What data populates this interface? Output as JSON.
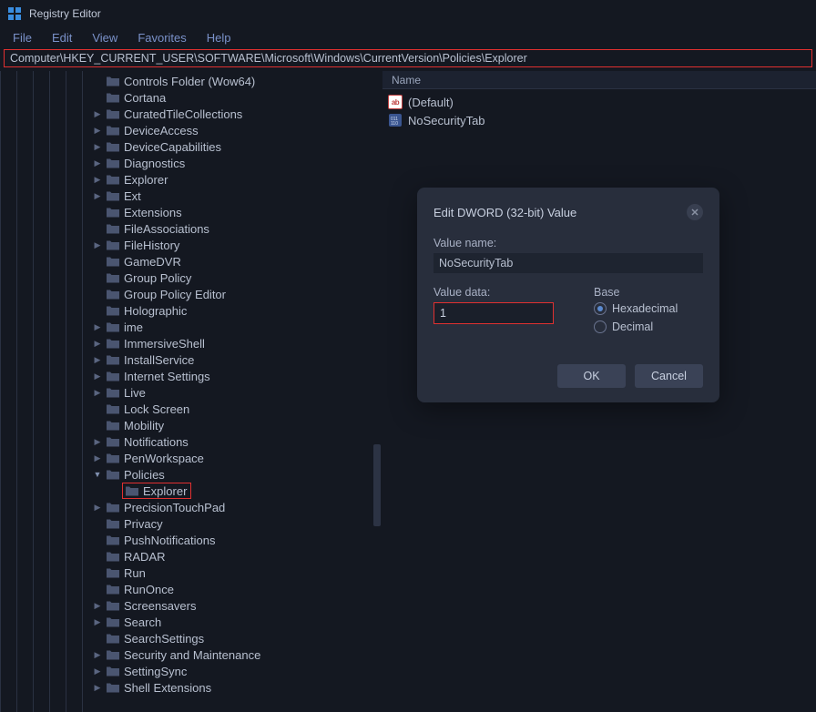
{
  "app": {
    "title": "Registry Editor"
  },
  "menu": {
    "file": "File",
    "edit": "Edit",
    "view": "View",
    "favorites": "Favorites",
    "help": "Help"
  },
  "path": "Computer\\HKEY_CURRENT_USER\\SOFTWARE\\Microsoft\\Windows\\CurrentVersion\\Policies\\Explorer",
  "tree": {
    "items": [
      {
        "label": "Controls Folder (Wow64)",
        "exp": false
      },
      {
        "label": "Cortana",
        "exp": false
      },
      {
        "label": "CuratedTileCollections",
        "exp": true
      },
      {
        "label": "DeviceAccess",
        "exp": true
      },
      {
        "label": "DeviceCapabilities",
        "exp": true
      },
      {
        "label": "Diagnostics",
        "exp": true
      },
      {
        "label": "Explorer",
        "exp": true
      },
      {
        "label": "Ext",
        "exp": true
      },
      {
        "label": "Extensions",
        "exp": false
      },
      {
        "label": "FileAssociations",
        "exp": false
      },
      {
        "label": "FileHistory",
        "exp": true
      },
      {
        "label": "GameDVR",
        "exp": false
      },
      {
        "label": "Group Policy",
        "exp": false
      },
      {
        "label": "Group Policy Editor",
        "exp": false
      },
      {
        "label": "Holographic",
        "exp": false
      },
      {
        "label": "ime",
        "exp": true
      },
      {
        "label": "ImmersiveShell",
        "exp": true
      },
      {
        "label": "InstallService",
        "exp": true
      },
      {
        "label": "Internet Settings",
        "exp": true
      },
      {
        "label": "Live",
        "exp": true
      },
      {
        "label": "Lock Screen",
        "exp": false
      },
      {
        "label": "Mobility",
        "exp": false
      },
      {
        "label": "Notifications",
        "exp": true
      },
      {
        "label": "PenWorkspace",
        "exp": true
      },
      {
        "label": "Policies",
        "exp": true,
        "open": true
      },
      {
        "label": "Explorer",
        "child": true,
        "highlighted": true
      },
      {
        "label": "PrecisionTouchPad",
        "exp": true
      },
      {
        "label": "Privacy",
        "exp": false
      },
      {
        "label": "PushNotifications",
        "exp": false
      },
      {
        "label": "RADAR",
        "exp": false
      },
      {
        "label": "Run",
        "exp": false
      },
      {
        "label": "RunOnce",
        "exp": false
      },
      {
        "label": "Screensavers",
        "exp": true
      },
      {
        "label": "Search",
        "exp": true
      },
      {
        "label": "SearchSettings",
        "exp": false
      },
      {
        "label": "Security and Maintenance",
        "exp": true
      },
      {
        "label": "SettingSync",
        "exp": true
      },
      {
        "label": "Shell Extensions",
        "exp": true
      }
    ]
  },
  "list": {
    "header": "Name",
    "items": [
      {
        "label": "(Default)",
        "type": "ab"
      },
      {
        "label": "NoSecurityTab",
        "type": "bin"
      }
    ]
  },
  "dialog": {
    "title": "Edit DWORD (32-bit) Value",
    "name_label": "Value name:",
    "name_value": "NoSecurityTab",
    "data_label": "Value data:",
    "data_value": "1",
    "base_label": "Base",
    "radio_hex": "Hexadecimal",
    "radio_dec": "Decimal",
    "ok": "OK",
    "cancel": "Cancel"
  }
}
